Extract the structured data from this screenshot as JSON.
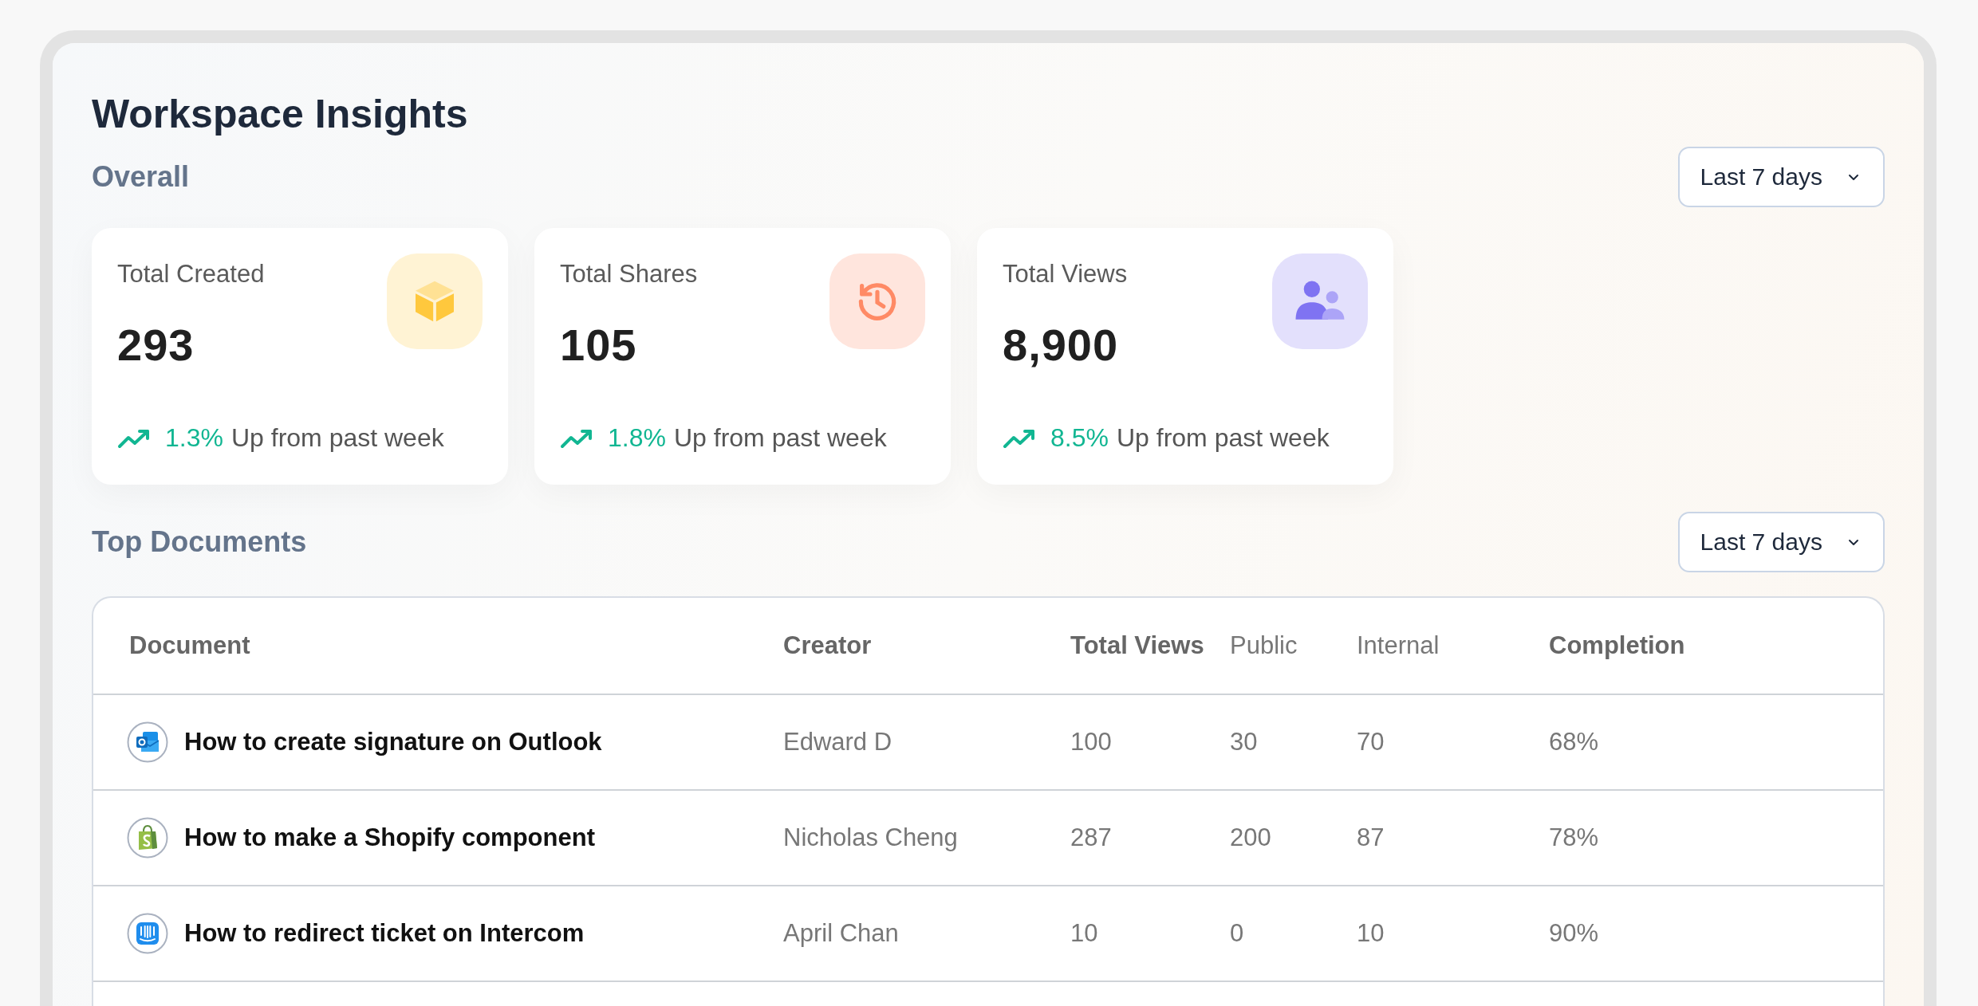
{
  "page": {
    "title": "Workspace Insights"
  },
  "overall": {
    "heading": "Overall",
    "range": "Last 7 days",
    "cards": [
      {
        "label": "Total Created",
        "value": "293",
        "change": "1.3%",
        "caption": "Up from past week",
        "kind": "created",
        "color": "#ffc83d"
      },
      {
        "label": "Total Shares",
        "value": "105",
        "change": "1.8%",
        "caption": "Up from past week",
        "kind": "shares",
        "color": "#ff8a65"
      },
      {
        "label": "Total Views",
        "value": "8,900",
        "change": "8.5%",
        "caption": "Up from past week",
        "kind": "views",
        "color": "#7f73f2"
      }
    ]
  },
  "top_documents": {
    "heading": "Top Documents",
    "range": "Last 7 days",
    "columns": [
      {
        "label": "Document",
        "bold": true
      },
      {
        "label": "Creator",
        "bold": true
      },
      {
        "label": "Total Views",
        "bold": true
      },
      {
        "label": "Public",
        "bold": false
      },
      {
        "label": "Internal",
        "bold": false
      },
      {
        "label": "Completion",
        "bold": true
      }
    ],
    "rows": [
      {
        "document": "How to create signature on Outlook",
        "creator": "Edward D",
        "total_views": "100",
        "public": "30",
        "internal": "70",
        "completion": "68%"
      },
      {
        "document": "How to make a Shopify component",
        "creator": "Nicholas Cheng",
        "total_views": "287",
        "public": "200",
        "internal": "87",
        "completion": "78%"
      },
      {
        "document": "How to redirect ticket on Intercom",
        "creator": "April Chan",
        "total_views": "10",
        "public": "0",
        "internal": "10",
        "completion": "90%"
      }
    ]
  }
}
